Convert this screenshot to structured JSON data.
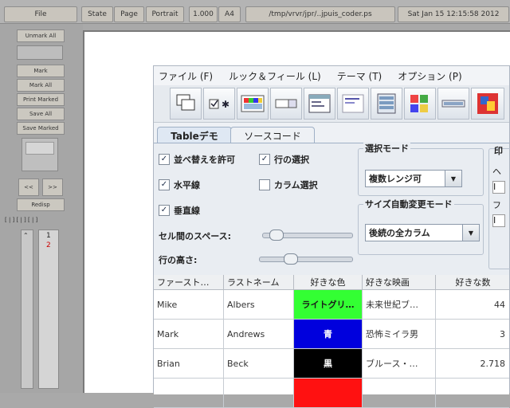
{
  "toolbar": {
    "file": "File",
    "state": "State",
    "page": "Page",
    "orientation": "Portrait",
    "zoom": "1.000",
    "paper": "A4",
    "path": "/tmp/vrvr/jpr/..jpuis_coder.ps",
    "date": "Sat Jan 15 12:15:58 2012"
  },
  "left_panel": {
    "buttons": [
      "Unmark All",
      "Mark",
      "Mark All",
      "Print Marked",
      "Save All",
      "Save Marked"
    ],
    "nav_prev": "<<",
    "nav_next": ">>",
    "redisplay": "Redisp",
    "page_list_header": "[ | ] [ | ] [ | ]",
    "page_list": [
      "1",
      "2"
    ]
  },
  "demo": {
    "menu": [
      "ファイル (F)",
      "ルック＆フィール (L)",
      "テーマ (T)",
      "オプション (P)"
    ],
    "tabs": [
      "Tableデモ",
      "ソースコード"
    ],
    "checkboxes": [
      {
        "label": "並べ替えを許可",
        "checked": true
      },
      {
        "label": "行の選択",
        "checked": true
      },
      {
        "label": "水平線",
        "checked": true
      },
      {
        "label": "カラム選択",
        "checked": false
      },
      {
        "label": "垂直線",
        "checked": true
      }
    ],
    "selection_mode": {
      "title": "選択モード",
      "value": "複数レンジ可"
    },
    "resize_mode": {
      "title": "サイズ自動変更モード",
      "value": "後続の全カラム"
    },
    "slider_spacing": {
      "label": "セル間のスペース:",
      "value": 0.08
    },
    "slider_height": {
      "label": "行の高さ:",
      "value": 0.3
    },
    "right_edge": [
      "印",
      "ヘ",
      "I",
      "フ",
      "I"
    ],
    "table": {
      "headers": [
        "ファースト…",
        "ラストネーム",
        "好きな色",
        "好きな映画",
        "好きな数"
      ],
      "rows": [
        {
          "first": "Mike",
          "last": "Albers",
          "color_name": "ライトグリ…",
          "color_hex": "#33ff33",
          "color_text": "#1a1a1a",
          "movie": "未来世紀ブ…",
          "number": "44"
        },
        {
          "first": "Mark",
          "last": "Andrews",
          "color_name": "青",
          "color_hex": "#0000dd",
          "color_text": "#ffffff",
          "movie": "恐怖ミイラ男",
          "number": "3"
        },
        {
          "first": "Brian",
          "last": "Beck",
          "color_name": "黒",
          "color_hex": "#000000",
          "color_text": "#ffffff",
          "movie": "ブルース・…",
          "number": "2.718"
        },
        {
          "first": "",
          "last": "",
          "color_name": "",
          "color_hex": "#ff1111",
          "color_text": "#ffffff",
          "movie": "",
          "number": ""
        }
      ]
    }
  }
}
